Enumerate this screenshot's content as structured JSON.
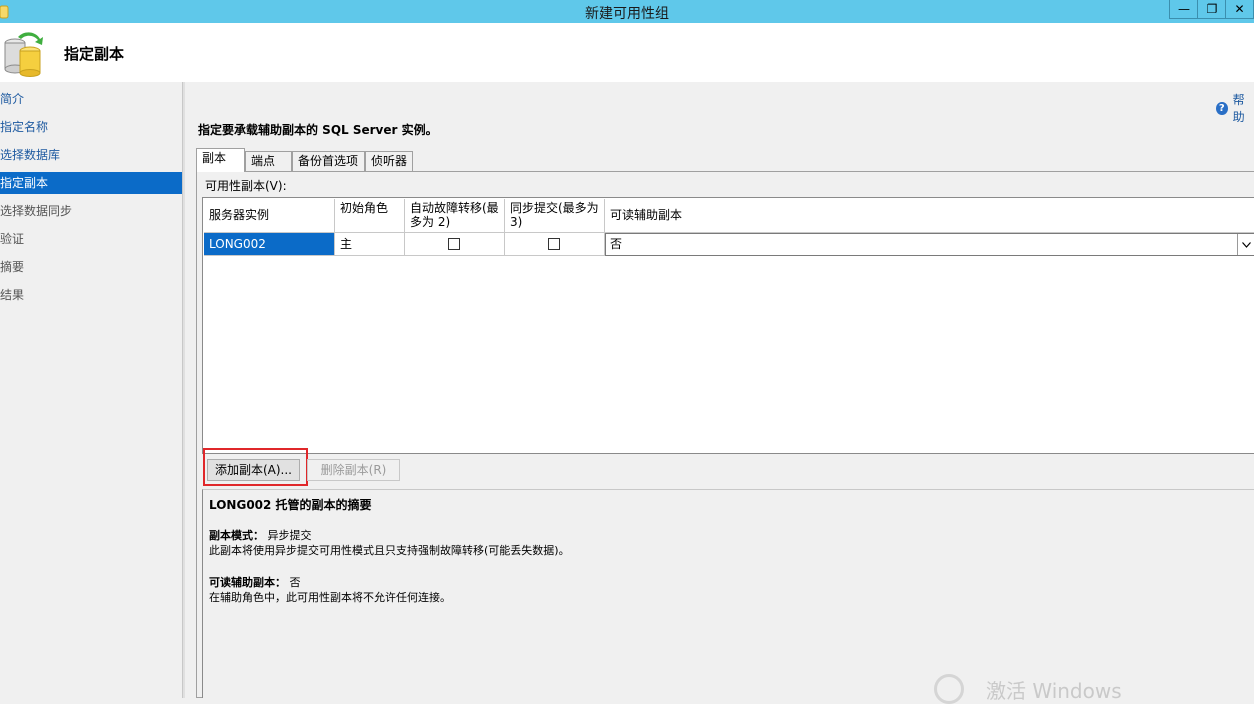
{
  "window": {
    "title": "新建可用性组",
    "controls": [
      "—",
      "❐",
      "✕"
    ]
  },
  "header": {
    "title": "指定副本"
  },
  "sidebar": {
    "items": [
      {
        "label": "简介",
        "state": "link"
      },
      {
        "label": "指定名称",
        "state": "link"
      },
      {
        "label": "选择数据库",
        "state": "link"
      },
      {
        "label": "指定副本",
        "state": "active"
      },
      {
        "label": "选择数据同步",
        "state": "disabled"
      },
      {
        "label": "验证",
        "state": "disabled"
      },
      {
        "label": "摘要",
        "state": "disabled"
      },
      {
        "label": "结果",
        "state": "disabled"
      }
    ]
  },
  "help": {
    "label": "帮助"
  },
  "instruction": "指定要承载辅助副本的 SQL Server 实例。",
  "tabs": [
    "副本",
    "端点",
    "备份首选项",
    "侦听器"
  ],
  "grid": {
    "label": "可用性副本(V):",
    "columns": [
      "服务器实例",
      "初始角色",
      "自动故障转移(最多为 2)",
      "同步提交(最多为 3)",
      "可读辅助副本"
    ],
    "rows": [
      {
        "server": "LONG002",
        "role": "主",
        "auto_failover": false,
        "sync_commit": false,
        "readable": "否"
      }
    ]
  },
  "buttons": {
    "add": "添加副本(A)...",
    "remove": "删除副本(R)"
  },
  "summary": {
    "title": "LONG002 托管的副本的摘要",
    "mode_label": "副本模式：",
    "mode_value": "异步提交",
    "mode_desc": "此副本将使用异步提交可用性模式且只支持强制故障转移(可能丢失数据)。",
    "readable_label": "可读辅助副本：",
    "readable_value": "否",
    "readable_desc": "在辅助角色中，此可用性副本将不允许任何连接。"
  },
  "watermark": "激活 Windows",
  "colors": {
    "titlebar": "#5fc8ea",
    "selection": "#0b6bc8",
    "link": "#1e5aa0",
    "highlight_box": "#e0272a"
  }
}
